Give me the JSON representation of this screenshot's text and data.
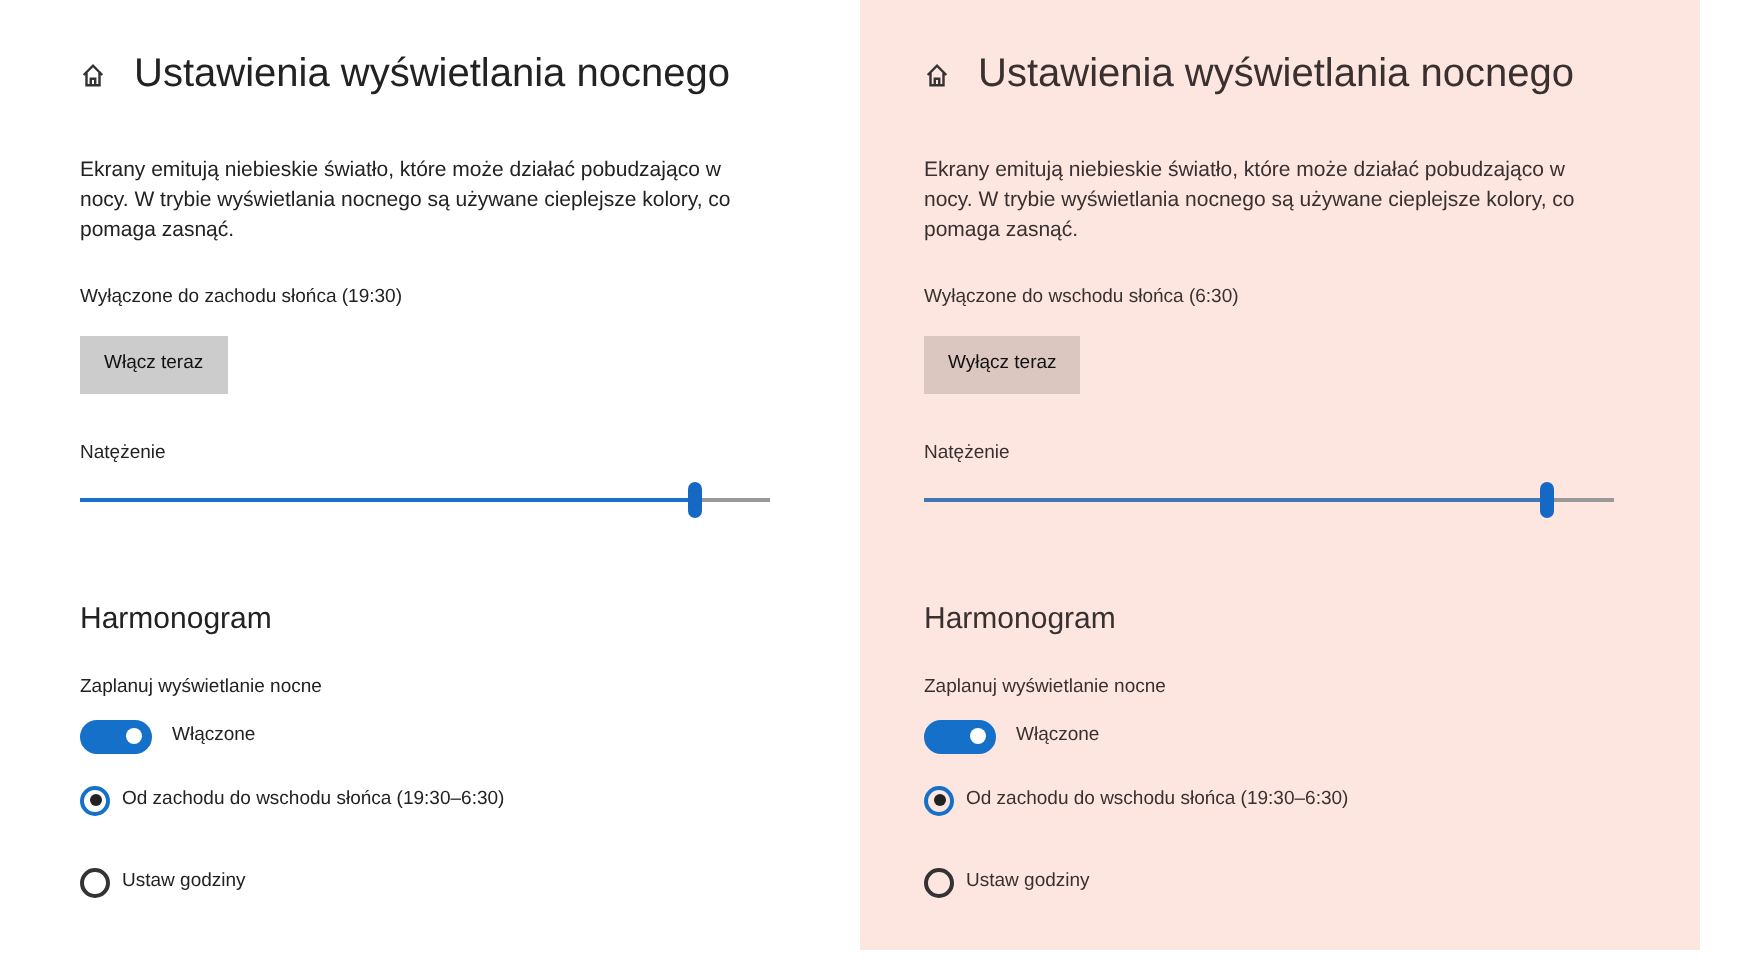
{
  "panels": [
    {
      "night_light": false,
      "title": "Ustawienia wyświetlania nocnego",
      "description": "Ekrany emitują niebieskie światło, które może działać pobudzająco w nocy. W trybie wyświetlania nocnego są używane cieplejsze kolory, co pomaga zasnąć.",
      "status": "Wyłączone do zachodu słońca (19:30)",
      "button": "Włącz teraz",
      "slider": {
        "label": "Natężenie",
        "level": 0.89
      },
      "schedule": {
        "heading": "Harmonogram",
        "toggle_label": "Zaplanuj wyświetlanie nocne",
        "toggle": {
          "on": true,
          "label": "Włączone"
        },
        "options": [
          {
            "label": "Od zachodu do wschodu słońca (19:30–6:30)",
            "selected": true
          },
          {
            "label": "Ustaw godziny",
            "selected": false
          }
        ]
      }
    },
    {
      "night_light": true,
      "title": "Ustawienia wyświetlania nocnego",
      "description": "Ekrany emitują niebieskie światło, które może działać pobudzająco w nocy. W trybie wyświetlania nocnego są używane cieplejsze kolory, co pomaga zasnąć.",
      "status": "Wyłączone do wschodu słońca (6:30)",
      "button": "Wyłącz teraz",
      "slider": {
        "label": "Natężenie",
        "level": 0.9
      },
      "schedule": {
        "heading": "Harmonogram",
        "toggle_label": "Zaplanuj wyświetlanie nocne",
        "toggle": {
          "on": true,
          "label": "Włączone"
        },
        "options": [
          {
            "label": "Od zachodu do wschodu słońca (19:30–6:30)",
            "selected": true
          },
          {
            "label": "Ustaw godziny",
            "selected": false
          }
        ]
      }
    }
  ]
}
